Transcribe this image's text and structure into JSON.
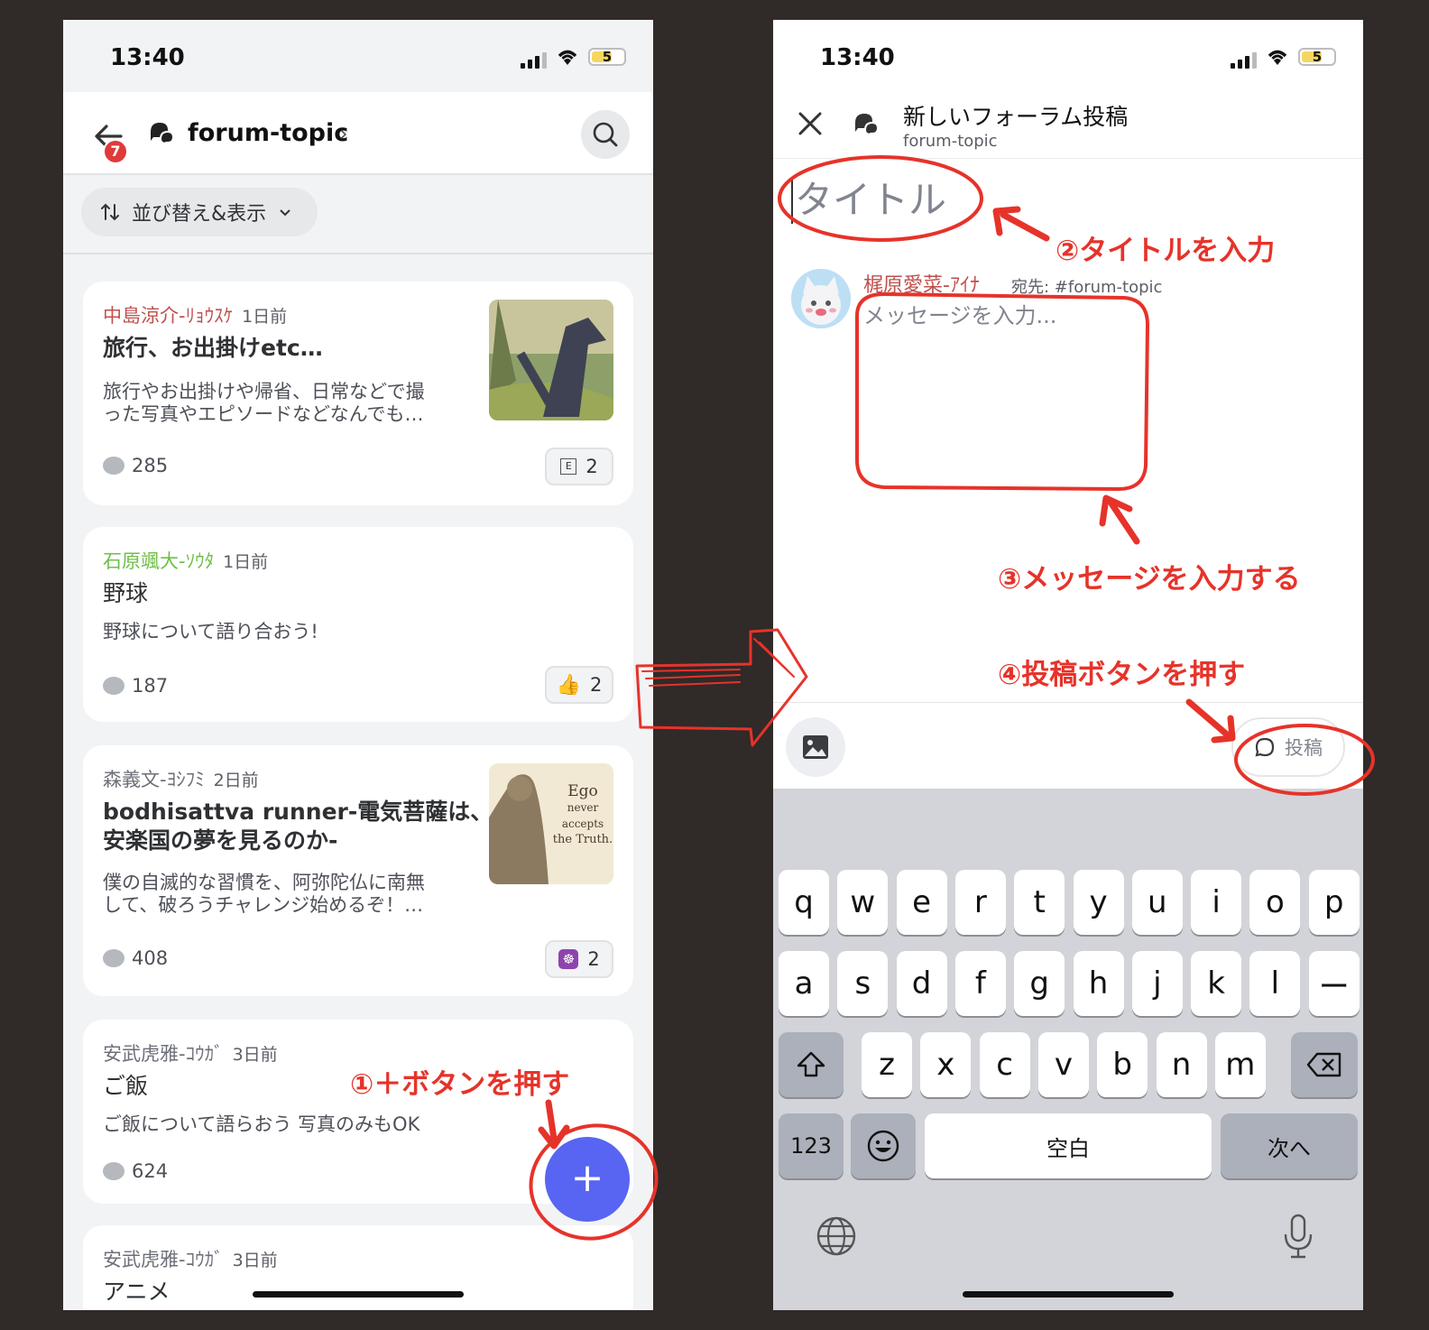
{
  "status_bar": {
    "time": "13:40",
    "battery": "5"
  },
  "left_screen": {
    "header": {
      "badge_count": "7",
      "channel_name": "forum-topic",
      "chevron": "›"
    },
    "sort_button": {
      "label": "並び替え&表示"
    },
    "posts": [
      {
        "author": "中島涼介-ﾘｮｳｽｹ",
        "author_color": "#c0504d",
        "age": "1日前",
        "title": "旅行、お出掛けetc…",
        "desc_line1": "旅行やお出掛けや帰省、日常などで撮",
        "desc_line2": "った写真やエピソードなどなんでも…",
        "comments": "285",
        "reaction_count": "2",
        "reaction_icon": "e-box-emoji"
      },
      {
        "author": "石原颯大-ｿｳﾀ",
        "author_color": "#6fbf4a",
        "age": "1日前",
        "title": "野球",
        "desc_line1": "野球について語り合おう!",
        "comments": "187",
        "reaction_count": "2",
        "reaction_icon": "thumbs-up-emoji"
      },
      {
        "author": "森義文-ﾖｼﾌﾐ",
        "author_color": "#6d6f78",
        "age": "2日前",
        "title_line1": "bodhisattva runner-電気菩薩は、",
        "title_line2": "安楽国の夢を見るのか-",
        "desc_line1": "僕の自滅的な習慣を、阿弥陀仏に南無",
        "desc_line2": "して、破ろうチャレンジ始めるぞ！…",
        "comments": "408",
        "reaction_count": "2",
        "reaction_icon": "dharma-wheel-emoji",
        "thumb_text1": "Ego",
        "thumb_text2": "never",
        "thumb_text3": "accepts",
        "thumb_text4": "the Truth."
      },
      {
        "author": "安武虎雅-ｺｳｶﾞ",
        "author_color": "#6d6f78",
        "age": "3日前",
        "title": "ご飯",
        "desc_line1": "ご飯について語らおう 写真のみもOK",
        "comments": "624"
      },
      {
        "author": "安武虎雅-ｺｳｶﾞ",
        "author_color": "#6d6f78",
        "age": "3日前",
        "title": "アニメ"
      }
    ],
    "fab_label": "+"
  },
  "right_screen": {
    "header": {
      "title": "新しいフォーラム投稿",
      "subtitle": "forum-topic"
    },
    "title_placeholder": "タイトル",
    "message": {
      "author": "梶原愛菜-ｱｲﾅ",
      "to": "宛先: #forum-topic",
      "placeholder": "メッセージを入力..."
    },
    "post_button": "投稿",
    "keyboard": {
      "row1": [
        "q",
        "w",
        "e",
        "r",
        "t",
        "y",
        "u",
        "i",
        "o",
        "p"
      ],
      "row2": [
        "a",
        "s",
        "d",
        "f",
        "g",
        "h",
        "j",
        "k",
        "l",
        "ー"
      ],
      "row3": [
        "z",
        "x",
        "c",
        "v",
        "b",
        "n",
        "m"
      ],
      "num_key": "123",
      "space_key": "空白",
      "return_key": "次へ"
    }
  },
  "annotations": {
    "step1": "①＋ボタンを押す",
    "step2": "②タイトルを入力",
    "step3": "③メッセージを入力する",
    "step4": "④投稿ボタンを押す",
    "color": "#e6332a"
  }
}
